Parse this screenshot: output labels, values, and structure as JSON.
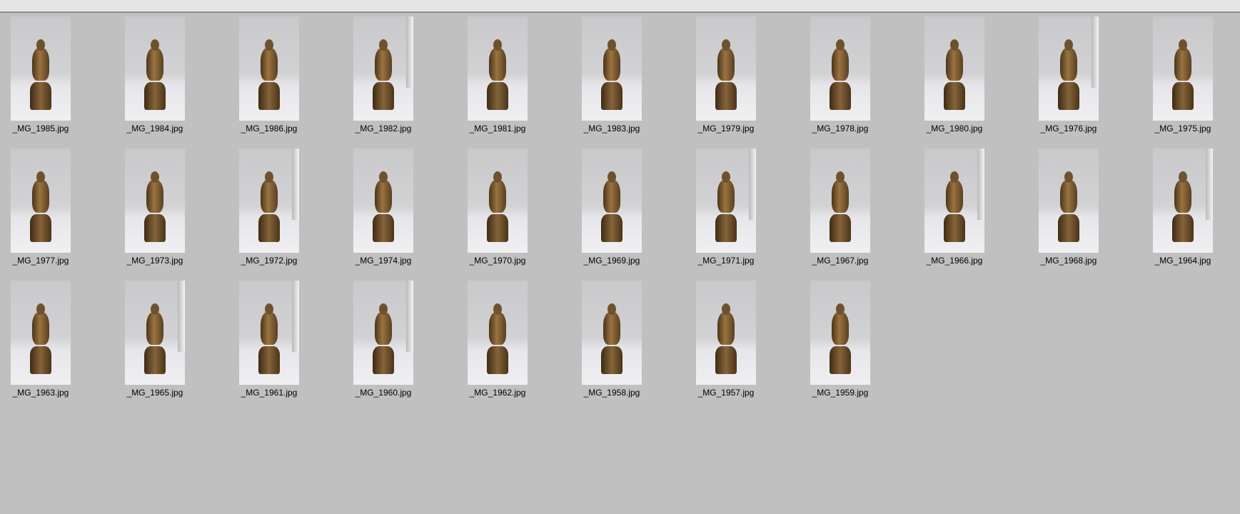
{
  "files": [
    "_MG_1985.jpg",
    "_MG_1984.jpg",
    "_MG_1986.jpg",
    "_MG_1982.jpg",
    "_MG_1981.jpg",
    "_MG_1983.jpg",
    "_MG_1979.jpg",
    "_MG_1978.jpg",
    "_MG_1980.jpg",
    "_MG_1976.jpg",
    "_MG_1975.jpg",
    "_MG_1977.jpg",
    "_MG_1973.jpg",
    "_MG_1972.jpg",
    "_MG_1974.jpg",
    "_MG_1970.jpg",
    "_MG_1969.jpg",
    "_MG_1971.jpg",
    "_MG_1967.jpg",
    "_MG_1966.jpg",
    "_MG_1968.jpg",
    "_MG_1964.jpg",
    "_MG_1963.jpg",
    "_MG_1965.jpg",
    "_MG_1961.jpg",
    "_MG_1960.jpg",
    "_MG_1962.jpg",
    "_MG_1958.jpg",
    "_MG_1957.jpg",
    "_MG_1959.jpg"
  ],
  "window_hint": [
    3,
    9,
    13,
    17,
    19,
    21,
    23,
    24,
    25
  ]
}
